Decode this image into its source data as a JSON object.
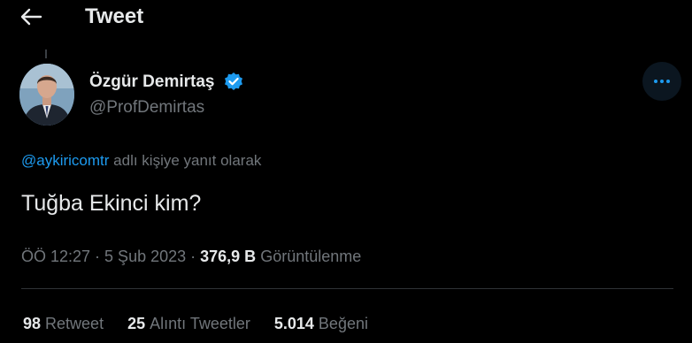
{
  "header": {
    "title": "Tweet",
    "back_icon": "arrow-left-icon"
  },
  "author": {
    "name": "Özgür Demirtaş",
    "handle": "@ProfDemirtas",
    "verified_icon": "verified-badge-icon",
    "verified_color": "#1d9bf0"
  },
  "reply_context": {
    "mention": "@aykiricomtr",
    "suffix": " adlı kişiye yanıt olarak"
  },
  "tweet": {
    "text": "Tuğba Ekinci kim?"
  },
  "meta": {
    "time": "ÖÖ 12:27",
    "separator": " · ",
    "date": "5 Şub 2023",
    "views_count": "376,9 B",
    "views_label": " Görüntülenme"
  },
  "stats": [
    {
      "count": "98",
      "label": "Retweet"
    },
    {
      "count": "25",
      "label": "Alıntı Tweetler"
    },
    {
      "count": "5.014",
      "label": "Beğeni"
    }
  ],
  "colors": {
    "background": "#000000",
    "text": "#e7e9ea",
    "muted": "#71767b",
    "accent": "#1d9bf0"
  },
  "more_icon": "more-horizontal-icon"
}
